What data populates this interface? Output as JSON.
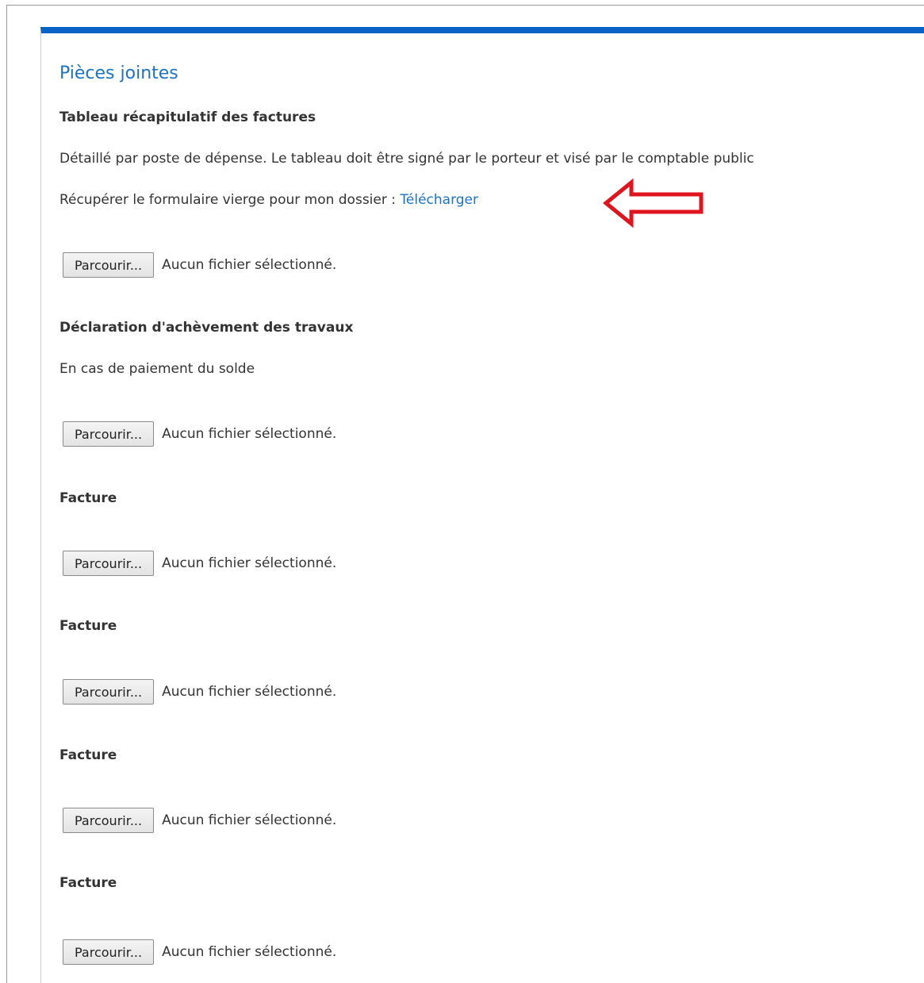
{
  "attachments": {
    "title": "Pièces jointes",
    "browse_label": "Parcourir...",
    "no_file_label": "Aucun fichier sélectionné.",
    "items": [
      {
        "label": "Tableau récapitulatif des factures",
        "description": "Détaillé par poste de dépense. Le tableau doit être signé par le porteur et visé par le comptable public",
        "download_prompt": "Récupérer le formulaire vierge pour mon dossier :",
        "download_link": "Télécharger"
      },
      {
        "label": "Déclaration d'achèvement des travaux",
        "description": "En cas de paiement du solde"
      },
      {
        "label": "Facture"
      },
      {
        "label": "Facture"
      },
      {
        "label": "Facture"
      },
      {
        "label": "Facture"
      }
    ]
  },
  "colors": {
    "accent_bar": "#0a64c8",
    "title": "#1a73c9",
    "link": "#1a73c9",
    "annotation_arrow": "#e0141e"
  },
  "annotation": {
    "icon": "arrow-left-icon"
  }
}
